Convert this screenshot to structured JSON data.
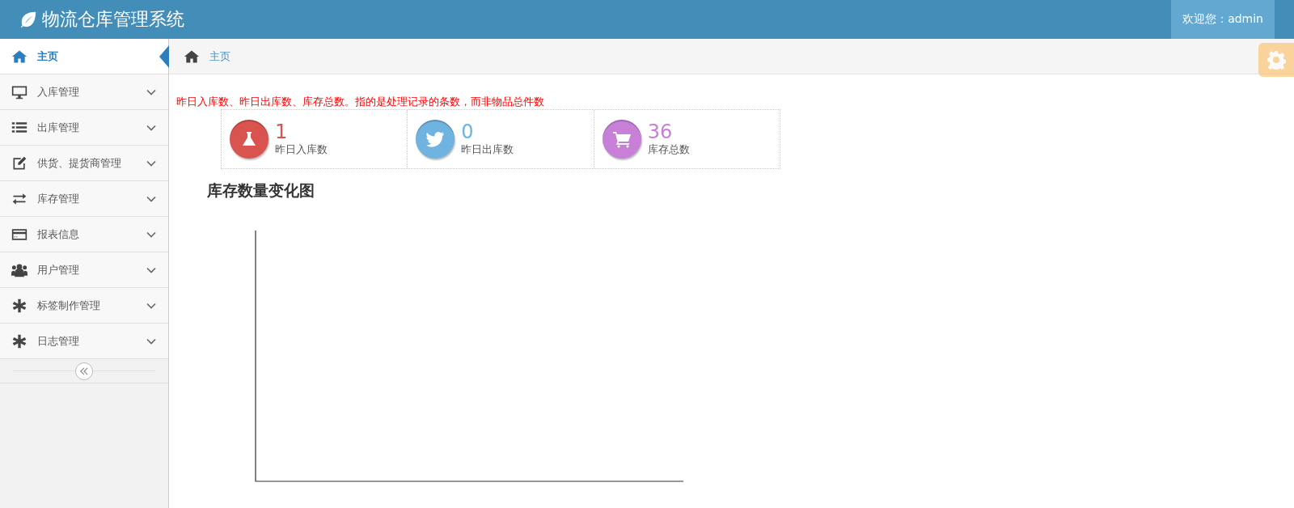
{
  "header": {
    "title": "物流仓库管理系统",
    "user": "欢迎您：admin"
  },
  "sidebar": {
    "items": [
      {
        "label": "主页",
        "kind": "link",
        "selected": true
      },
      {
        "label": "入库管理",
        "kind": "menu",
        "selected": false
      },
      {
        "label": "出库管理",
        "kind": "menu",
        "selected": false
      },
      {
        "label": "供货、提货商管理",
        "kind": "menu",
        "selected": false
      },
      {
        "label": "库存管理",
        "kind": "menu",
        "selected": false
      },
      {
        "label": "报表信息",
        "kind": "menu",
        "selected": false
      },
      {
        "label": "用户管理",
        "kind": "menu",
        "selected": false
      },
      {
        "label": "标签制作管理",
        "kind": "menu",
        "selected": false
      },
      {
        "label": "日志管理",
        "kind": "menu",
        "selected": false
      }
    ]
  },
  "breadcrumb": {
    "label": "主页"
  },
  "note": "昨日入库数、昨日出库数、库存总数。指的是处理记录的条数，而非物品总件数",
  "stats": [
    {
      "value": "1",
      "label": "昨日入库数",
      "color": "#d9534f"
    },
    {
      "value": "0",
      "label": "昨日出库数",
      "color": "#6fb3e0"
    },
    {
      "value": "36",
      "label": "库存总数",
      "color": "#c77fd8"
    }
  ],
  "chart": {
    "title": "库存数量变化图"
  }
}
